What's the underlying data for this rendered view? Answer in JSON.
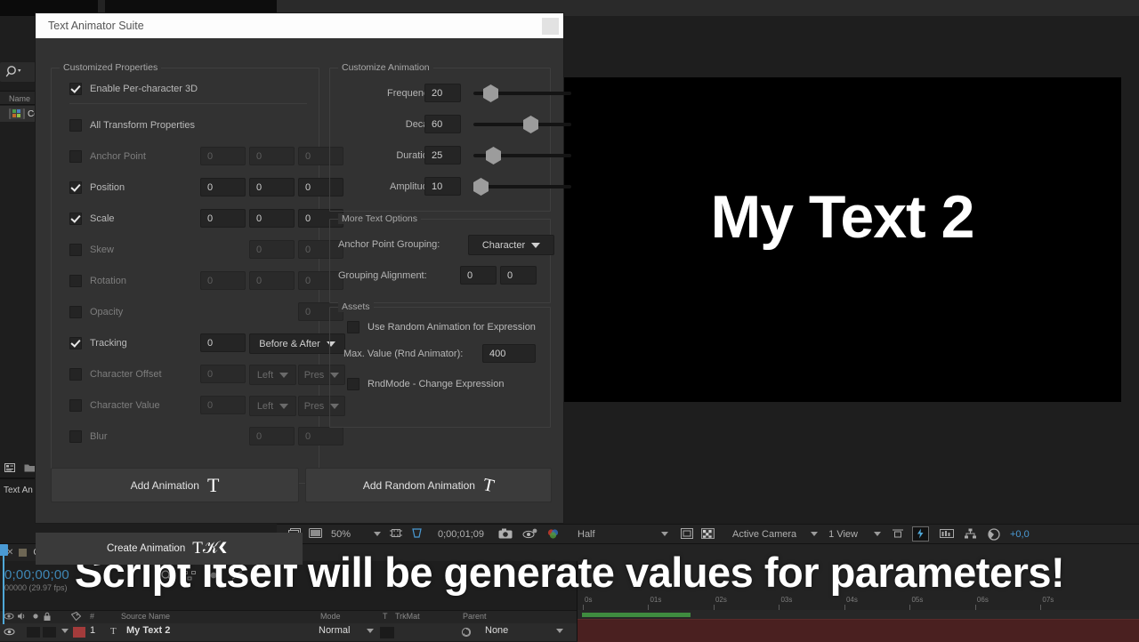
{
  "app": {
    "dialog_title": "Text Animator Suite",
    "close_label": ""
  },
  "project_panel": {
    "search_icon": "search-icon",
    "column_header": "Name",
    "item_label": "Co",
    "footer_icons": [
      "new-composition-icon",
      "new-folder-icon"
    ],
    "tab_label": "Text An"
  },
  "customized_properties": {
    "legend": "Customized Properties",
    "enable_3d": {
      "label": "Enable Per-character 3D",
      "checked": true
    },
    "rows": [
      {
        "label": "All Transform Properties",
        "checked": false,
        "fields": []
      },
      {
        "label": "Anchor Point",
        "checked": false,
        "fields": [
          "0",
          "0",
          "0"
        ],
        "enabled": false
      },
      {
        "label": "Position",
        "checked": true,
        "fields": [
          "0",
          "0",
          "0"
        ],
        "enabled": true
      },
      {
        "label": "Scale",
        "checked": true,
        "fields": [
          "0",
          "0",
          "0"
        ],
        "enabled": true
      },
      {
        "label": "Skew",
        "checked": false,
        "fields": [
          "0",
          "0"
        ],
        "enabled": false
      },
      {
        "label": "Rotation",
        "checked": false,
        "fields": [
          "0",
          "0",
          "0"
        ],
        "enabled": false
      },
      {
        "label": "Opacity",
        "checked": false,
        "fields": [
          "0"
        ],
        "enabled": false
      },
      {
        "label": "Tracking",
        "checked": true,
        "fields": [
          "0"
        ],
        "enabled": true,
        "dropdown": "Before & After"
      },
      {
        "label": "Character Offset",
        "checked": false,
        "fields": [
          "0"
        ],
        "enabled": false,
        "dropdowns": [
          "Left",
          "Pres"
        ]
      },
      {
        "label": "Character Value",
        "checked": false,
        "fields": [
          "0"
        ],
        "enabled": false,
        "dropdowns": [
          "Left",
          "Pres"
        ]
      },
      {
        "label": "Blur",
        "checked": false,
        "fields": [
          "0",
          "0"
        ],
        "enabled": false
      }
    ]
  },
  "customize_animation": {
    "legend": "Customize Animation",
    "sliders": [
      {
        "label": "Frequency:",
        "value": "20",
        "percent": 20
      },
      {
        "label": "Decay:",
        "value": "60",
        "percent": 60
      },
      {
        "label": "Duration:",
        "value": "25",
        "percent": 25
      },
      {
        "label": "Amplitude:",
        "value": "10",
        "percent": 10
      }
    ]
  },
  "more_text_options": {
    "legend": "More Text Options",
    "anchor_point_grouping": {
      "label": "Anchor Point Grouping:",
      "value": "Character"
    },
    "grouping_alignment": {
      "label": "Grouping Alignment:",
      "values": [
        "0",
        "0"
      ]
    }
  },
  "assets": {
    "legend": "Assets",
    "use_random": {
      "label": "Use Random Animation for Expression",
      "checked": false
    },
    "max_value": {
      "label": "Max. Value (Rnd Animator):",
      "value": "400"
    },
    "rnd_mode": {
      "label": "RndMode - Change Expression",
      "checked": false
    }
  },
  "buttons": {
    "add_animation": "Add Animation",
    "add_random_animation": "Add Random Animation",
    "create_animation": "Create Animation"
  },
  "comp_toolbar": {
    "zoom": "50%",
    "timecode": "0;00;01;09",
    "resolution": "Half",
    "camera": "Active Camera",
    "views": "1 View",
    "offset": "+0,0",
    "icons": [
      "always-preview-icon",
      "monitor-icon",
      "region-of-interest-icon",
      "transparency-grid-icon",
      "snapshot-icon",
      "show-snapshot-icon",
      "channel-icon",
      "mask-icon",
      "timeline-icon",
      "grid-icon",
      "guides-icon",
      "3d-renderer-icon"
    ]
  },
  "timeline": {
    "tab_label": "Comp Title",
    "current_time": "0;00;00;00",
    "frames": "00000 (29.97 fps)",
    "columns": {
      "source_name": "Source Name",
      "mode": "Mode",
      "t": "T",
      "trkmat": "TrkMat",
      "parent": "Parent",
      "hash": "#"
    },
    "layer": {
      "index": "1",
      "name": "My Text 2",
      "mode": "Normal",
      "parent": "None",
      "color": "#a33b3b"
    },
    "ruler_labels": [
      "0s",
      "01s",
      "02s",
      "03s",
      "04s",
      "05s",
      "06s",
      "07s"
    ],
    "work_area_color": "#3f8c3f",
    "layer_bar_color": "#4a2020",
    "cti_color": "#4fa8d8"
  },
  "preview": {
    "text": "My Text 2",
    "background": "#000000"
  },
  "caption": "Script itself will be generate values for parameters!"
}
